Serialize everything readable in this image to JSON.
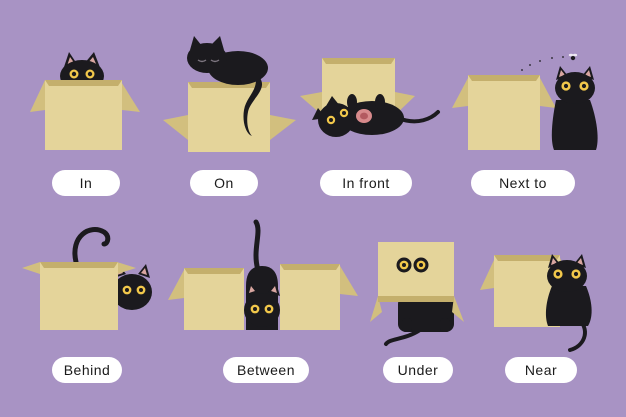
{
  "background_color": "#a893c4",
  "box_color": "#e4d49a",
  "cat_color": "#1b1a1e",
  "eye_color": "#f2c84b",
  "labels": {
    "in": "In",
    "on": "On",
    "in_front": "In front",
    "next_to": "Next to",
    "behind": "Behind",
    "between": "Between",
    "under": "Under",
    "near": "Near"
  }
}
